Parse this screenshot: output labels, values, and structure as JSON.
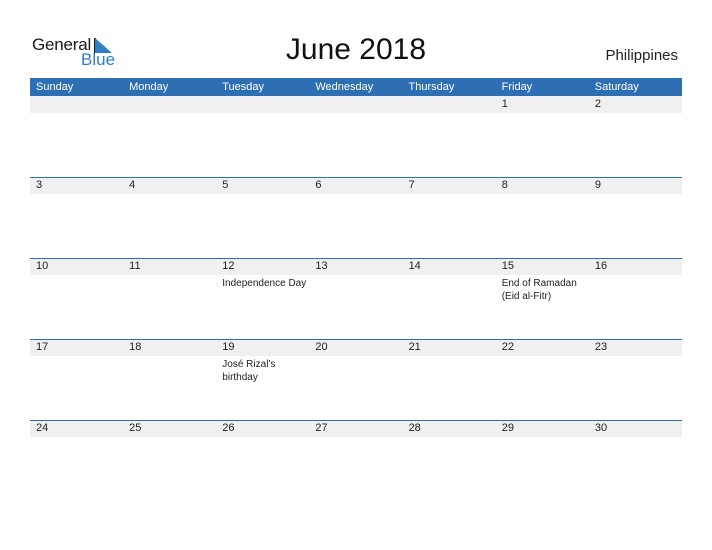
{
  "logo": {
    "line1": "General",
    "line2": "Blue"
  },
  "title": "June 2018",
  "country": "Philippines",
  "colors": {
    "accent": "#2e6fb3",
    "band": "#f0f0f0"
  },
  "weekdays": [
    "Sunday",
    "Monday",
    "Tuesday",
    "Wednesday",
    "Thursday",
    "Friday",
    "Saturday"
  ],
  "weeks": [
    [
      {
        "day": ""
      },
      {
        "day": ""
      },
      {
        "day": ""
      },
      {
        "day": ""
      },
      {
        "day": ""
      },
      {
        "day": "1"
      },
      {
        "day": "2"
      }
    ],
    [
      {
        "day": "3"
      },
      {
        "day": "4"
      },
      {
        "day": "5"
      },
      {
        "day": "6"
      },
      {
        "day": "7"
      },
      {
        "day": "8"
      },
      {
        "day": "9"
      }
    ],
    [
      {
        "day": "10"
      },
      {
        "day": "11"
      },
      {
        "day": "12",
        "event": "Independence Day"
      },
      {
        "day": "13"
      },
      {
        "day": "14"
      },
      {
        "day": "15",
        "event": "End of Ramadan (Eid al-Fitr)"
      },
      {
        "day": "16"
      }
    ],
    [
      {
        "day": "17"
      },
      {
        "day": "18"
      },
      {
        "day": "19",
        "event": "José Rizal's birthday"
      },
      {
        "day": "20"
      },
      {
        "day": "21"
      },
      {
        "day": "22"
      },
      {
        "day": "23"
      }
    ],
    [
      {
        "day": "24"
      },
      {
        "day": "25"
      },
      {
        "day": "26"
      },
      {
        "day": "27"
      },
      {
        "day": "28"
      },
      {
        "day": "29"
      },
      {
        "day": "30"
      }
    ]
  ]
}
